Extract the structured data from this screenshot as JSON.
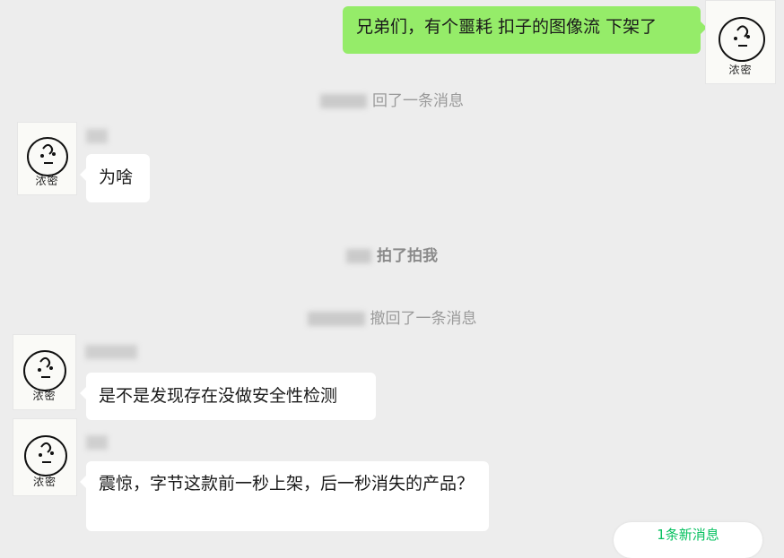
{
  "avatar_caption": "浓密",
  "messages": {
    "m1": "兄弟们，有个噩耗 扣子的图像流 下架了",
    "m2": "为啥",
    "m3": "是不是发现存在没做安全性检测",
    "m4": "震惊，字节这款前一秒上架，后一秒消失的产品？"
  },
  "system": {
    "recall1": "回了一条消息",
    "pat": "拍了拍我",
    "recall2": "撤回了一条消息"
  },
  "new_messages": "1条新消息"
}
